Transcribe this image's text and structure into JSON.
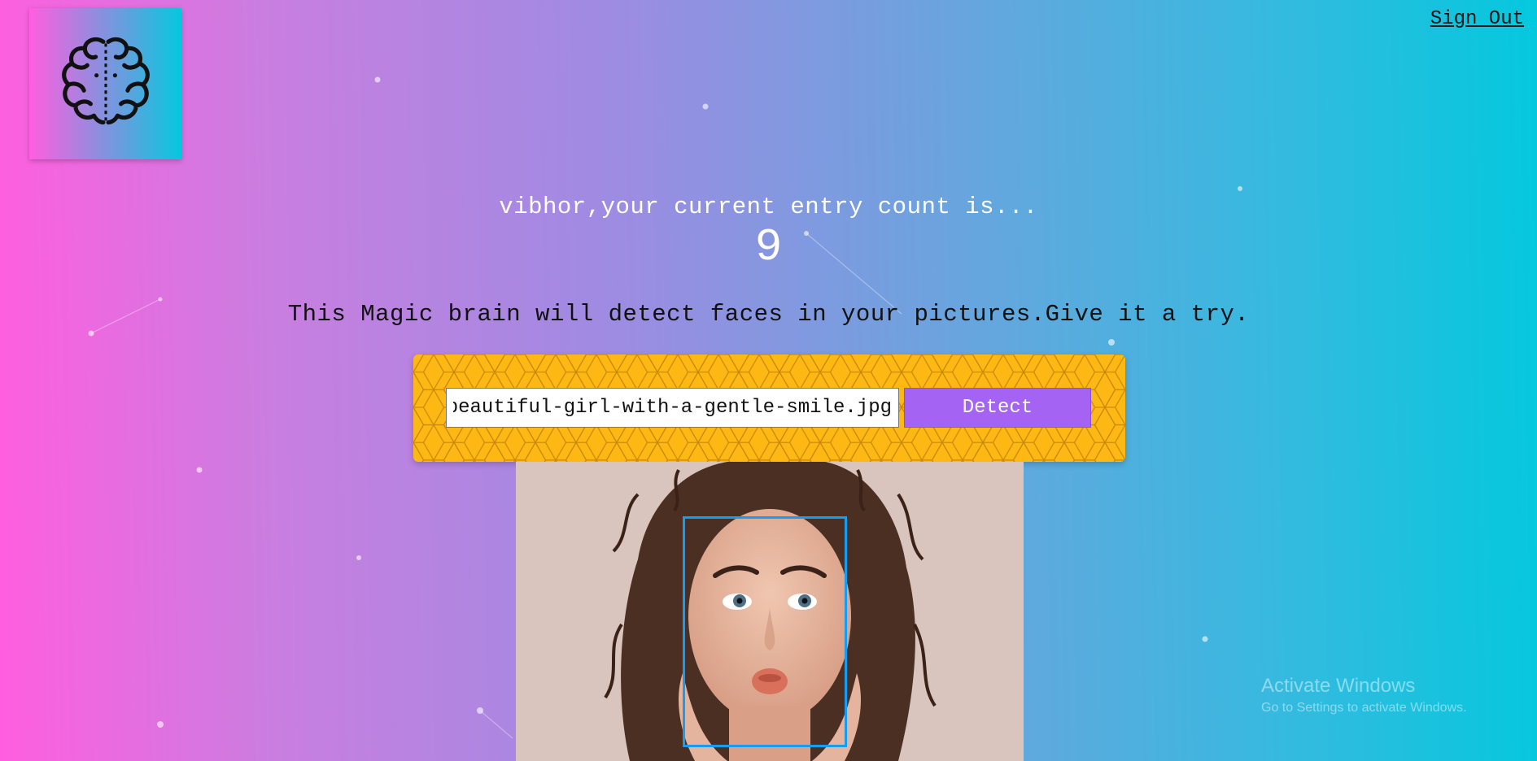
{
  "header": {
    "logo_icon": "brain-icon",
    "sign_out_label": "Sign Out"
  },
  "rank": {
    "message": "vibhor,your current entry count is...",
    "count": "9"
  },
  "intro": {
    "tagline": "This Magic brain will detect faces in your pictures.Give it a try."
  },
  "form": {
    "url_value": "beautiful-girl-with-a-gentle-smile.jpg",
    "detect_label": "Detect"
  },
  "colors": {
    "gradient_start": "#ff5edf",
    "gradient_end": "#04c8de",
    "panel_yellow": "#fdb813",
    "button_purple": "#a463f2",
    "face_box": "#149df2"
  },
  "watermark": {
    "line1": "Activate Windows",
    "line2": "Go to Settings to activate Windows."
  }
}
